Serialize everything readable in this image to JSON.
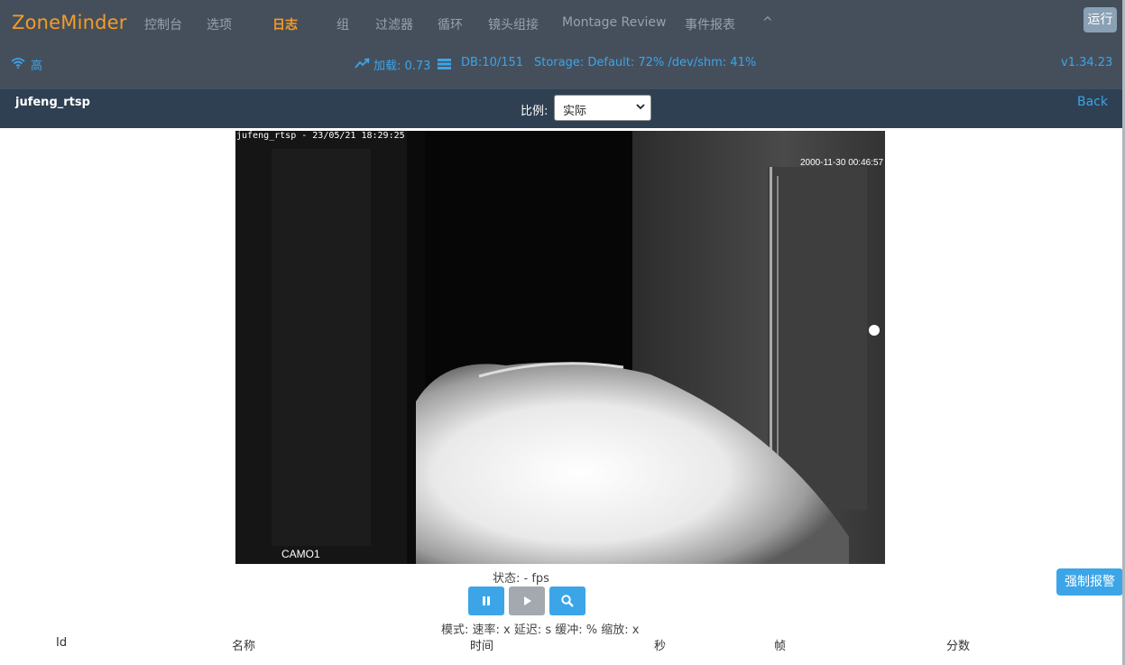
{
  "app": {
    "brand": "ZoneMinder",
    "run_label": "运行",
    "version": "v1.34.23"
  },
  "nav": [
    {
      "label": "控制台",
      "active": false
    },
    {
      "label": "选项",
      "active": false
    },
    {
      "label": "日志",
      "active": true
    },
    {
      "label": "组",
      "active": false
    },
    {
      "label": "过滤器",
      "active": false
    },
    {
      "label": "循环",
      "active": false
    },
    {
      "label": "镜头组接",
      "active": false
    },
    {
      "label": "Montage Review",
      "active": false
    },
    {
      "label": "事件报表",
      "active": false
    },
    {
      "label": "^",
      "active": false
    }
  ],
  "status": {
    "bandwidth": "高",
    "load": "加载: 0.73",
    "db": "DB:10/151",
    "storage": "Storage: Default: 72% /dev/shm: 41%"
  },
  "monitor": {
    "name": "jufeng_rtsp",
    "scale_label": "比例:",
    "scale_value": "实际",
    "back_label": "Back"
  },
  "video": {
    "overlay_top_left": "jufeng_rtsp - 23/05/21 18:29:25",
    "overlay_top_right": "2000-11-30 00:46:57",
    "overlay_bottom_left": "CAMO1"
  },
  "stream": {
    "status_line": "状态:  -  fps",
    "mode_line": "模式:   速率: x   延迟: s   缓冲: %   缩放: x",
    "force_alarm_label": "强制报警"
  },
  "events_table": {
    "columns": [
      "Id",
      "名称",
      "时间",
      "秒",
      "帧",
      "分数"
    ]
  },
  "colors": {
    "accent": "#f39c26",
    "link": "#3ba5e8",
    "nav_bg": "#454f5c",
    "header_bg": "#2e4052"
  }
}
